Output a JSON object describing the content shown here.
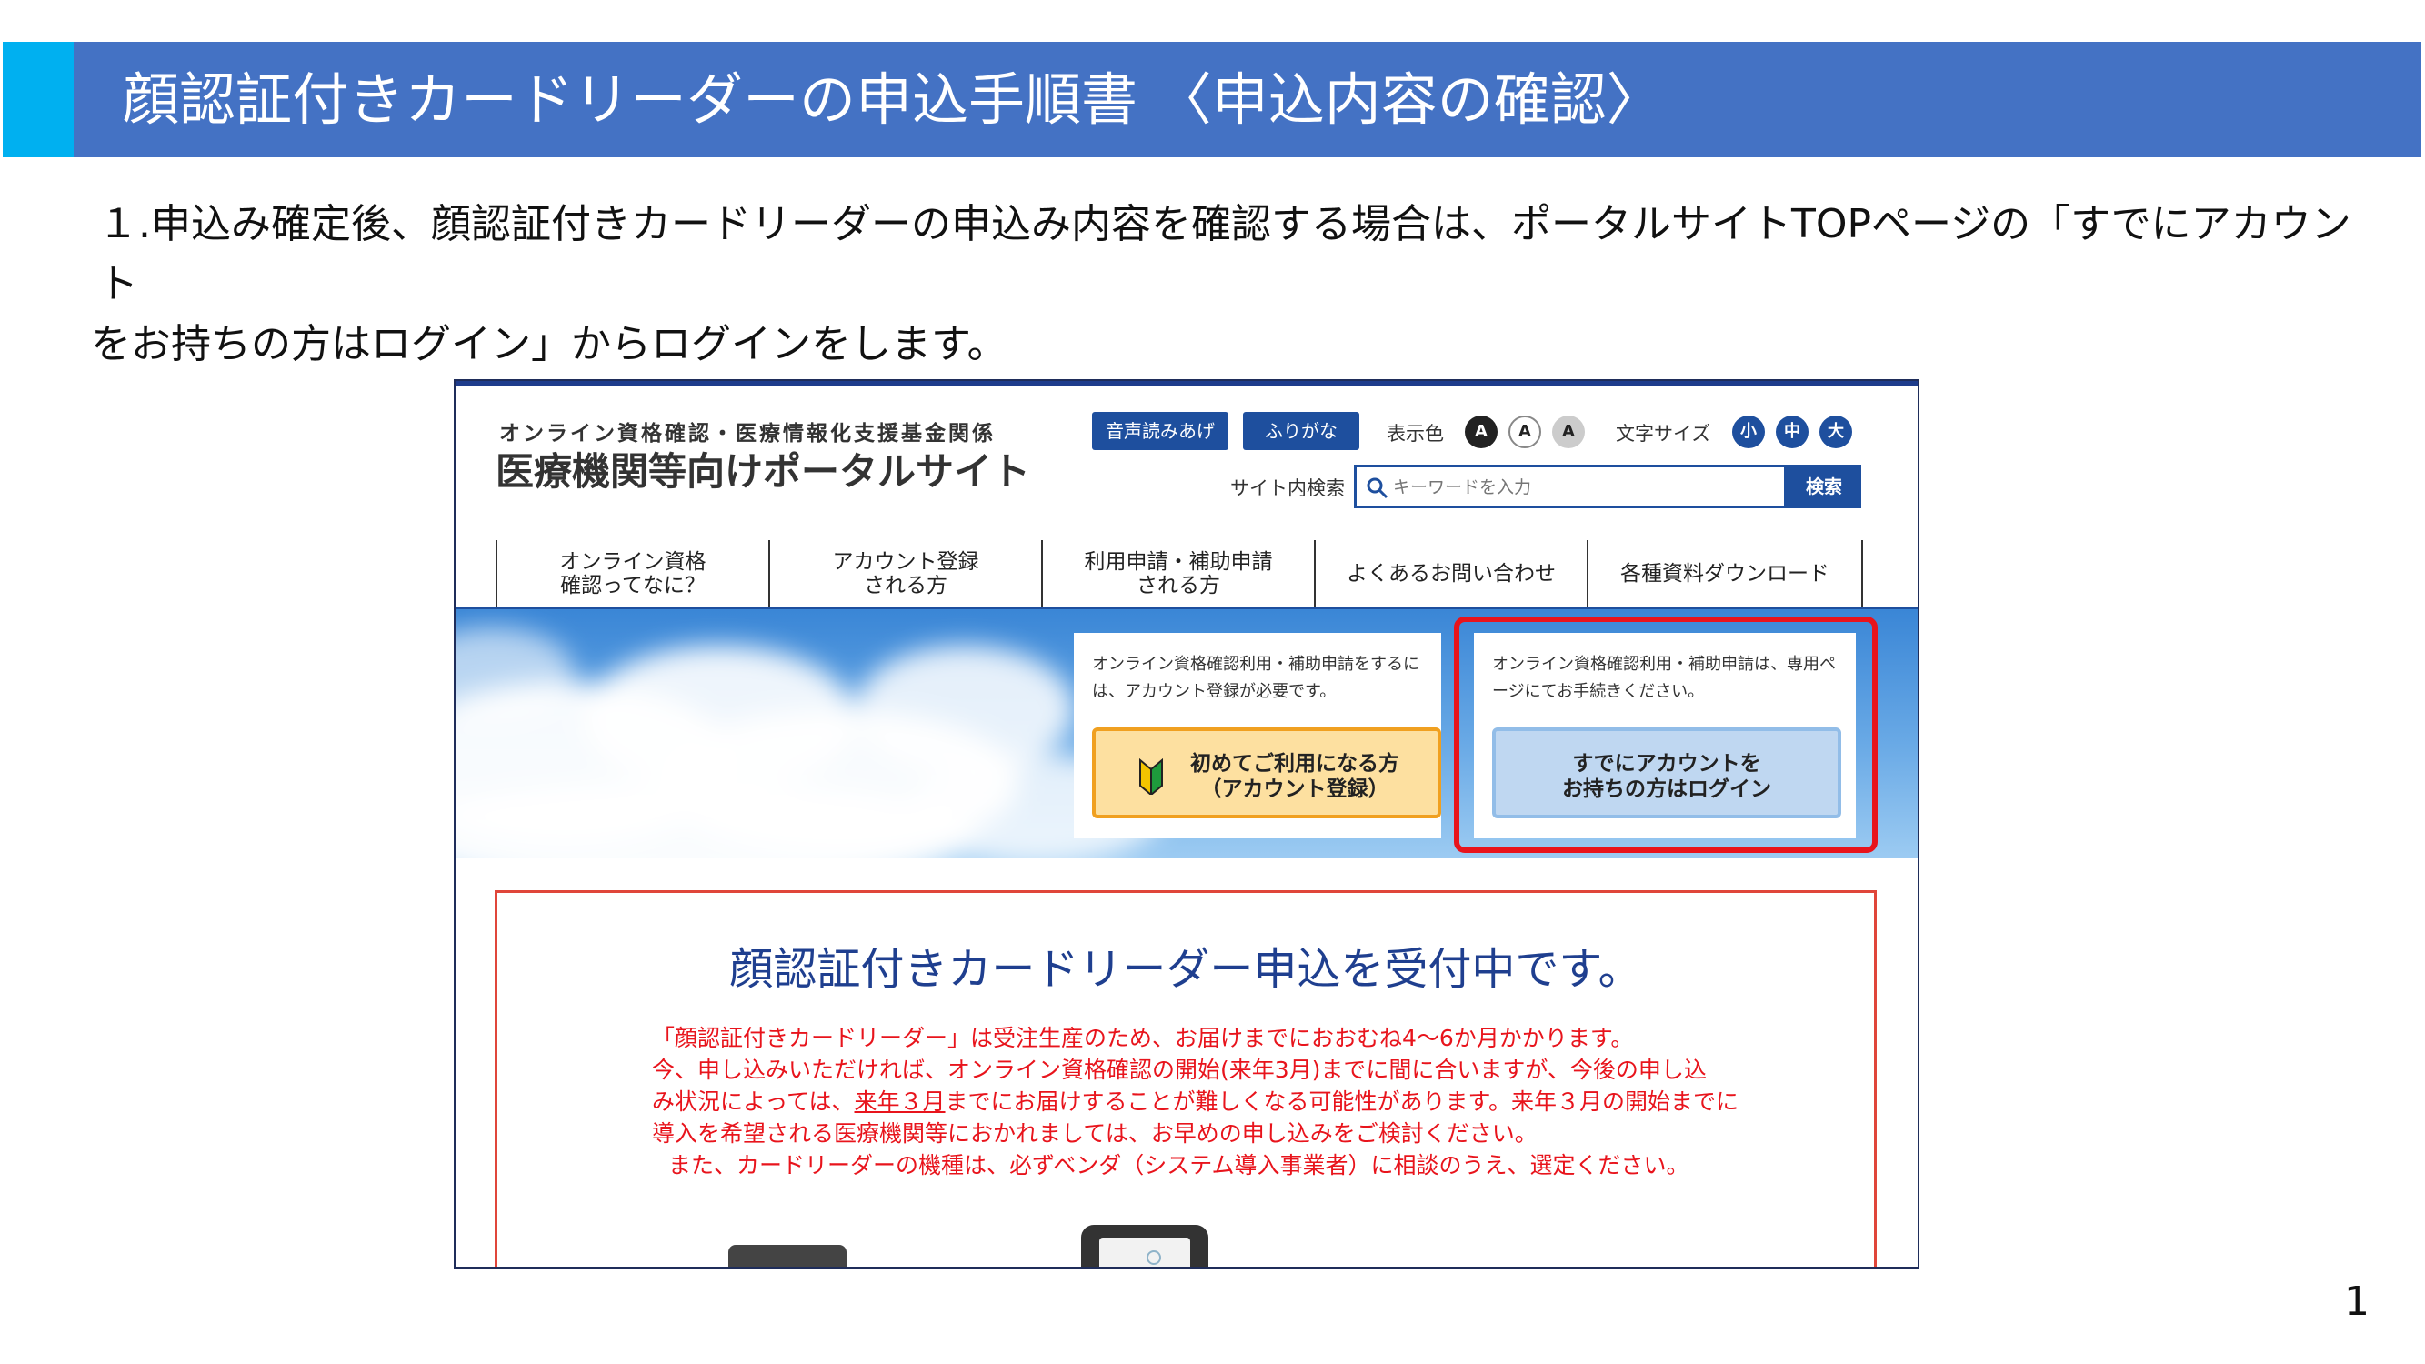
{
  "slide": {
    "title": "顔認証付きカードリーダーの申込手順書 〈申込内容の確認〉",
    "instruction_line1": "１.申込み確定後、顔認証付きカードリーダーの申込み内容を確認する場合は、ポータルサイトTOPページの「すでにアカウント",
    "instruction_line2": "をお持ちの方はログイン」からログインをします。",
    "page_number": "1"
  },
  "portal": {
    "org": "オンライン資格確認・医療情報化支援基金関係",
    "title": "医療機関等向けポータルサイト",
    "read_aloud": "音声読みあげ",
    "furigana": "ふりがな",
    "display_color_label": "表示色",
    "color_options": [
      "A",
      "A",
      "A"
    ],
    "font_size_label": "文字サイズ",
    "size_options": [
      "小",
      "中",
      "大"
    ],
    "search_label": "サイト内検索",
    "search_placeholder": "キーワードを入力",
    "search_button": "検索",
    "nav": [
      {
        "line1": "オンライン資格",
        "line2": "確認ってなに？"
      },
      {
        "line1": "アカウント登録",
        "line2": "される方"
      },
      {
        "line1": "利用申請・補助申請",
        "line2": "される方"
      },
      {
        "line1": "よくあるお問い合わせ",
        "line2": ""
      },
      {
        "line1": "各種資料ダウンロード",
        "line2": ""
      }
    ],
    "card_new": {
      "text": "オンライン資格確認利用・補助申請をするには、アカウント登録が必要です。",
      "button_line1": "初めてご利用になる方",
      "button_line2": "（アカウント登録）"
    },
    "card_login": {
      "text": "オンライン資格確認利用・補助申請は、専用ページにてお手続きください。",
      "button_line1": "すでにアカウントを",
      "button_line2": "お持ちの方はログイン"
    },
    "notice": {
      "title": "顔認証付きカードリーダー申込を受付中です。",
      "line1": "「顔認証付きカードリーダー」は受注生産のため、お届けまでにおおむね4～6か月かかります。",
      "line2": "今、申し込みいただければ、オンライン資格確認の開始(来年3月)までに間に合いますが、今後の申し込",
      "line3a": "み状況によっては、",
      "line3u": "来年３月",
      "line3b": "までにお届けすることが難しくなる可能性があります。来年３月の開始までに",
      "line4": "導入を希望される医療機関等におかれましては、お早めの申し込みをご検討ください。",
      "line5": "また、カードリーダーの機種は、必ずベンダ（システム導入事業者）に相談のうえ、選定ください。"
    }
  },
  "colors": {
    "title_bar": "#4472c4",
    "title_accent": "#00b0f0",
    "portal_blue": "#1e4f9e",
    "highlight_red": "#e8141c",
    "notice_text": "#e8141c"
  }
}
